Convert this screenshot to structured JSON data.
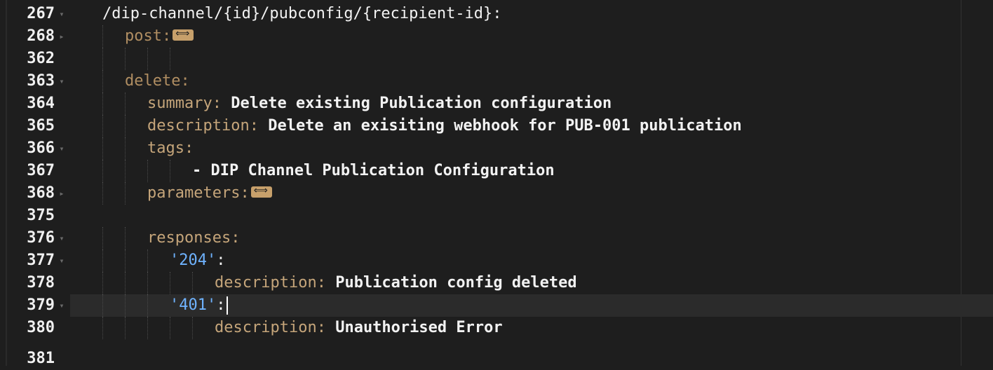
{
  "editor": {
    "lines": [
      {
        "num": "267",
        "fold": "▾",
        "text": "/dip-channel/{id}/pubconfig/{recipient-id}:"
      },
      {
        "num": "268",
        "fold": "▸",
        "key": "post",
        "collapsed": true
      },
      {
        "num": "362",
        "fold": ""
      },
      {
        "num": "363",
        "fold": "▾",
        "key": "delete"
      },
      {
        "num": "364",
        "fold": "",
        "key": "summary",
        "value": "Delete existing Publication configuration"
      },
      {
        "num": "365",
        "fold": "",
        "key": "description",
        "value": "Delete an exisiting webhook for PUB-001 publication"
      },
      {
        "num": "366",
        "fold": "▾",
        "key": "tags"
      },
      {
        "num": "367",
        "fold": "",
        "value": "- DIP Channel Publication Configuration"
      },
      {
        "num": "368",
        "fold": "▸",
        "key": "parameters",
        "collapsed": true
      },
      {
        "num": "375",
        "fold": ""
      },
      {
        "num": "376",
        "fold": "▾",
        "key": "responses"
      },
      {
        "num": "377",
        "fold": "▾",
        "str": "'204'"
      },
      {
        "num": "378",
        "fold": "",
        "key": "description",
        "value": "Publication config deleted"
      },
      {
        "num": "379",
        "fold": "▾",
        "str": "'401'",
        "active": true
      },
      {
        "num": "380",
        "fold": "",
        "key": "description",
        "value": "Unauthorised Error"
      },
      {
        "num": "381",
        "fold": ""
      }
    ]
  },
  "colors": {
    "background": "#1e1e1e",
    "key": "#c5a57a",
    "string": "#6fb3ff",
    "text": "#f2f2f2",
    "active_line": "#2b2b2b"
  },
  "icons": {
    "fold_open": "chevron-down-icon",
    "fold_closed": "chevron-right-icon",
    "collapsed_badge": "ellipsis-fold-icon"
  }
}
